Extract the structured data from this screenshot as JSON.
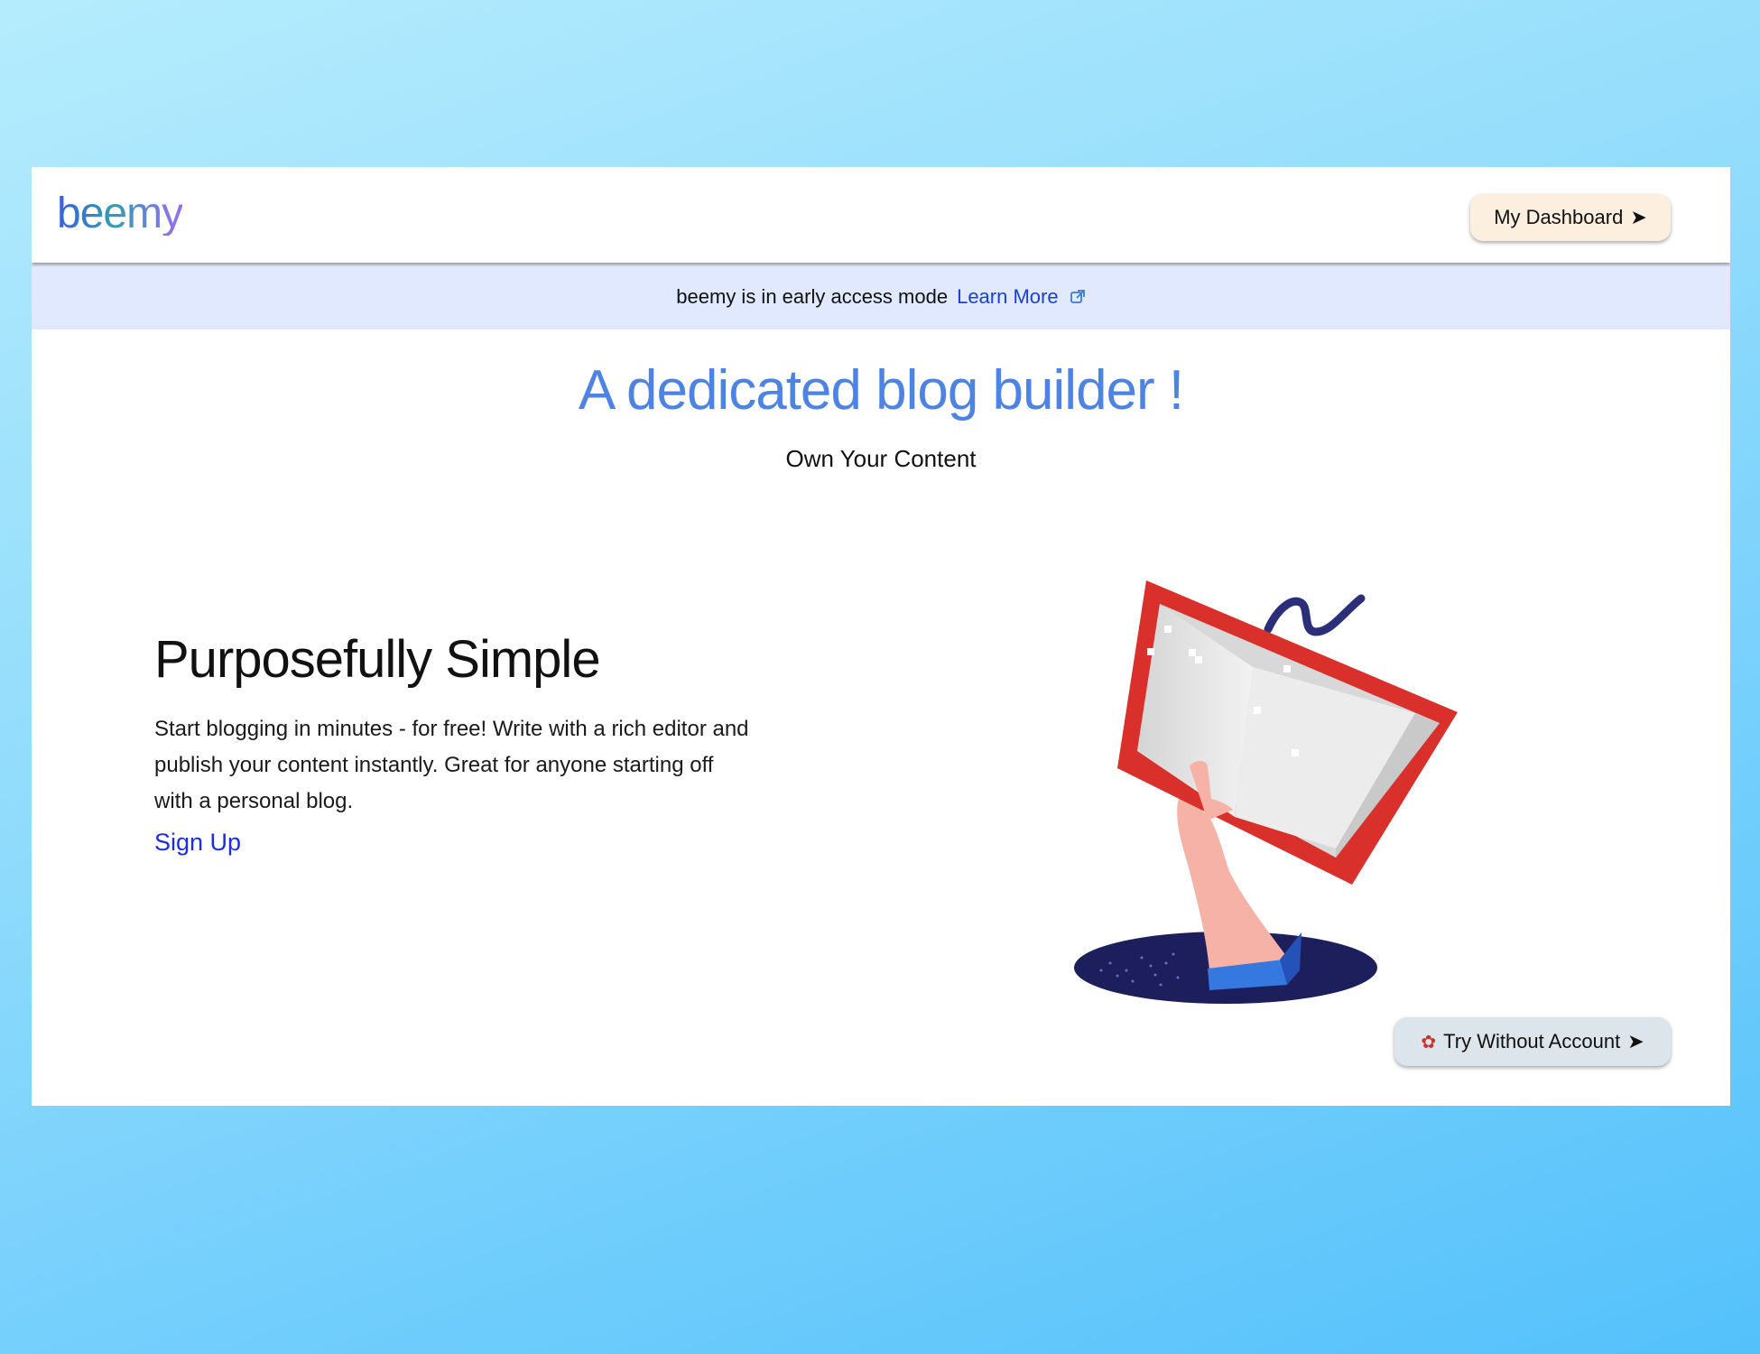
{
  "app": {
    "logo_text": "beemy"
  },
  "header": {
    "dashboard_label": "My Dashboard",
    "dashboard_icon": "arrow-right-icon"
  },
  "banner": {
    "text": "beemy is in early access mode",
    "link_label": "Learn More",
    "link_icon": "external-link-icon",
    "background": "#e0e9fd"
  },
  "hero": {
    "title": "A dedicated blog builder !",
    "subtitle": "Own Your Content",
    "title_color": "#4d84e4"
  },
  "feature": {
    "heading": "Purposefully Simple",
    "body": "Start blogging in minutes - for free! Write with a rich editor and publish your content instantly. Great for anyone starting off with a personal blog.",
    "cta_label": "Sign Up"
  },
  "illustration": {
    "name": "hand-holding-book-illustration"
  },
  "try_button": {
    "label": "Try Without Account",
    "icon": "octopus-icon",
    "arrow_icon": "arrow-right-icon"
  }
}
